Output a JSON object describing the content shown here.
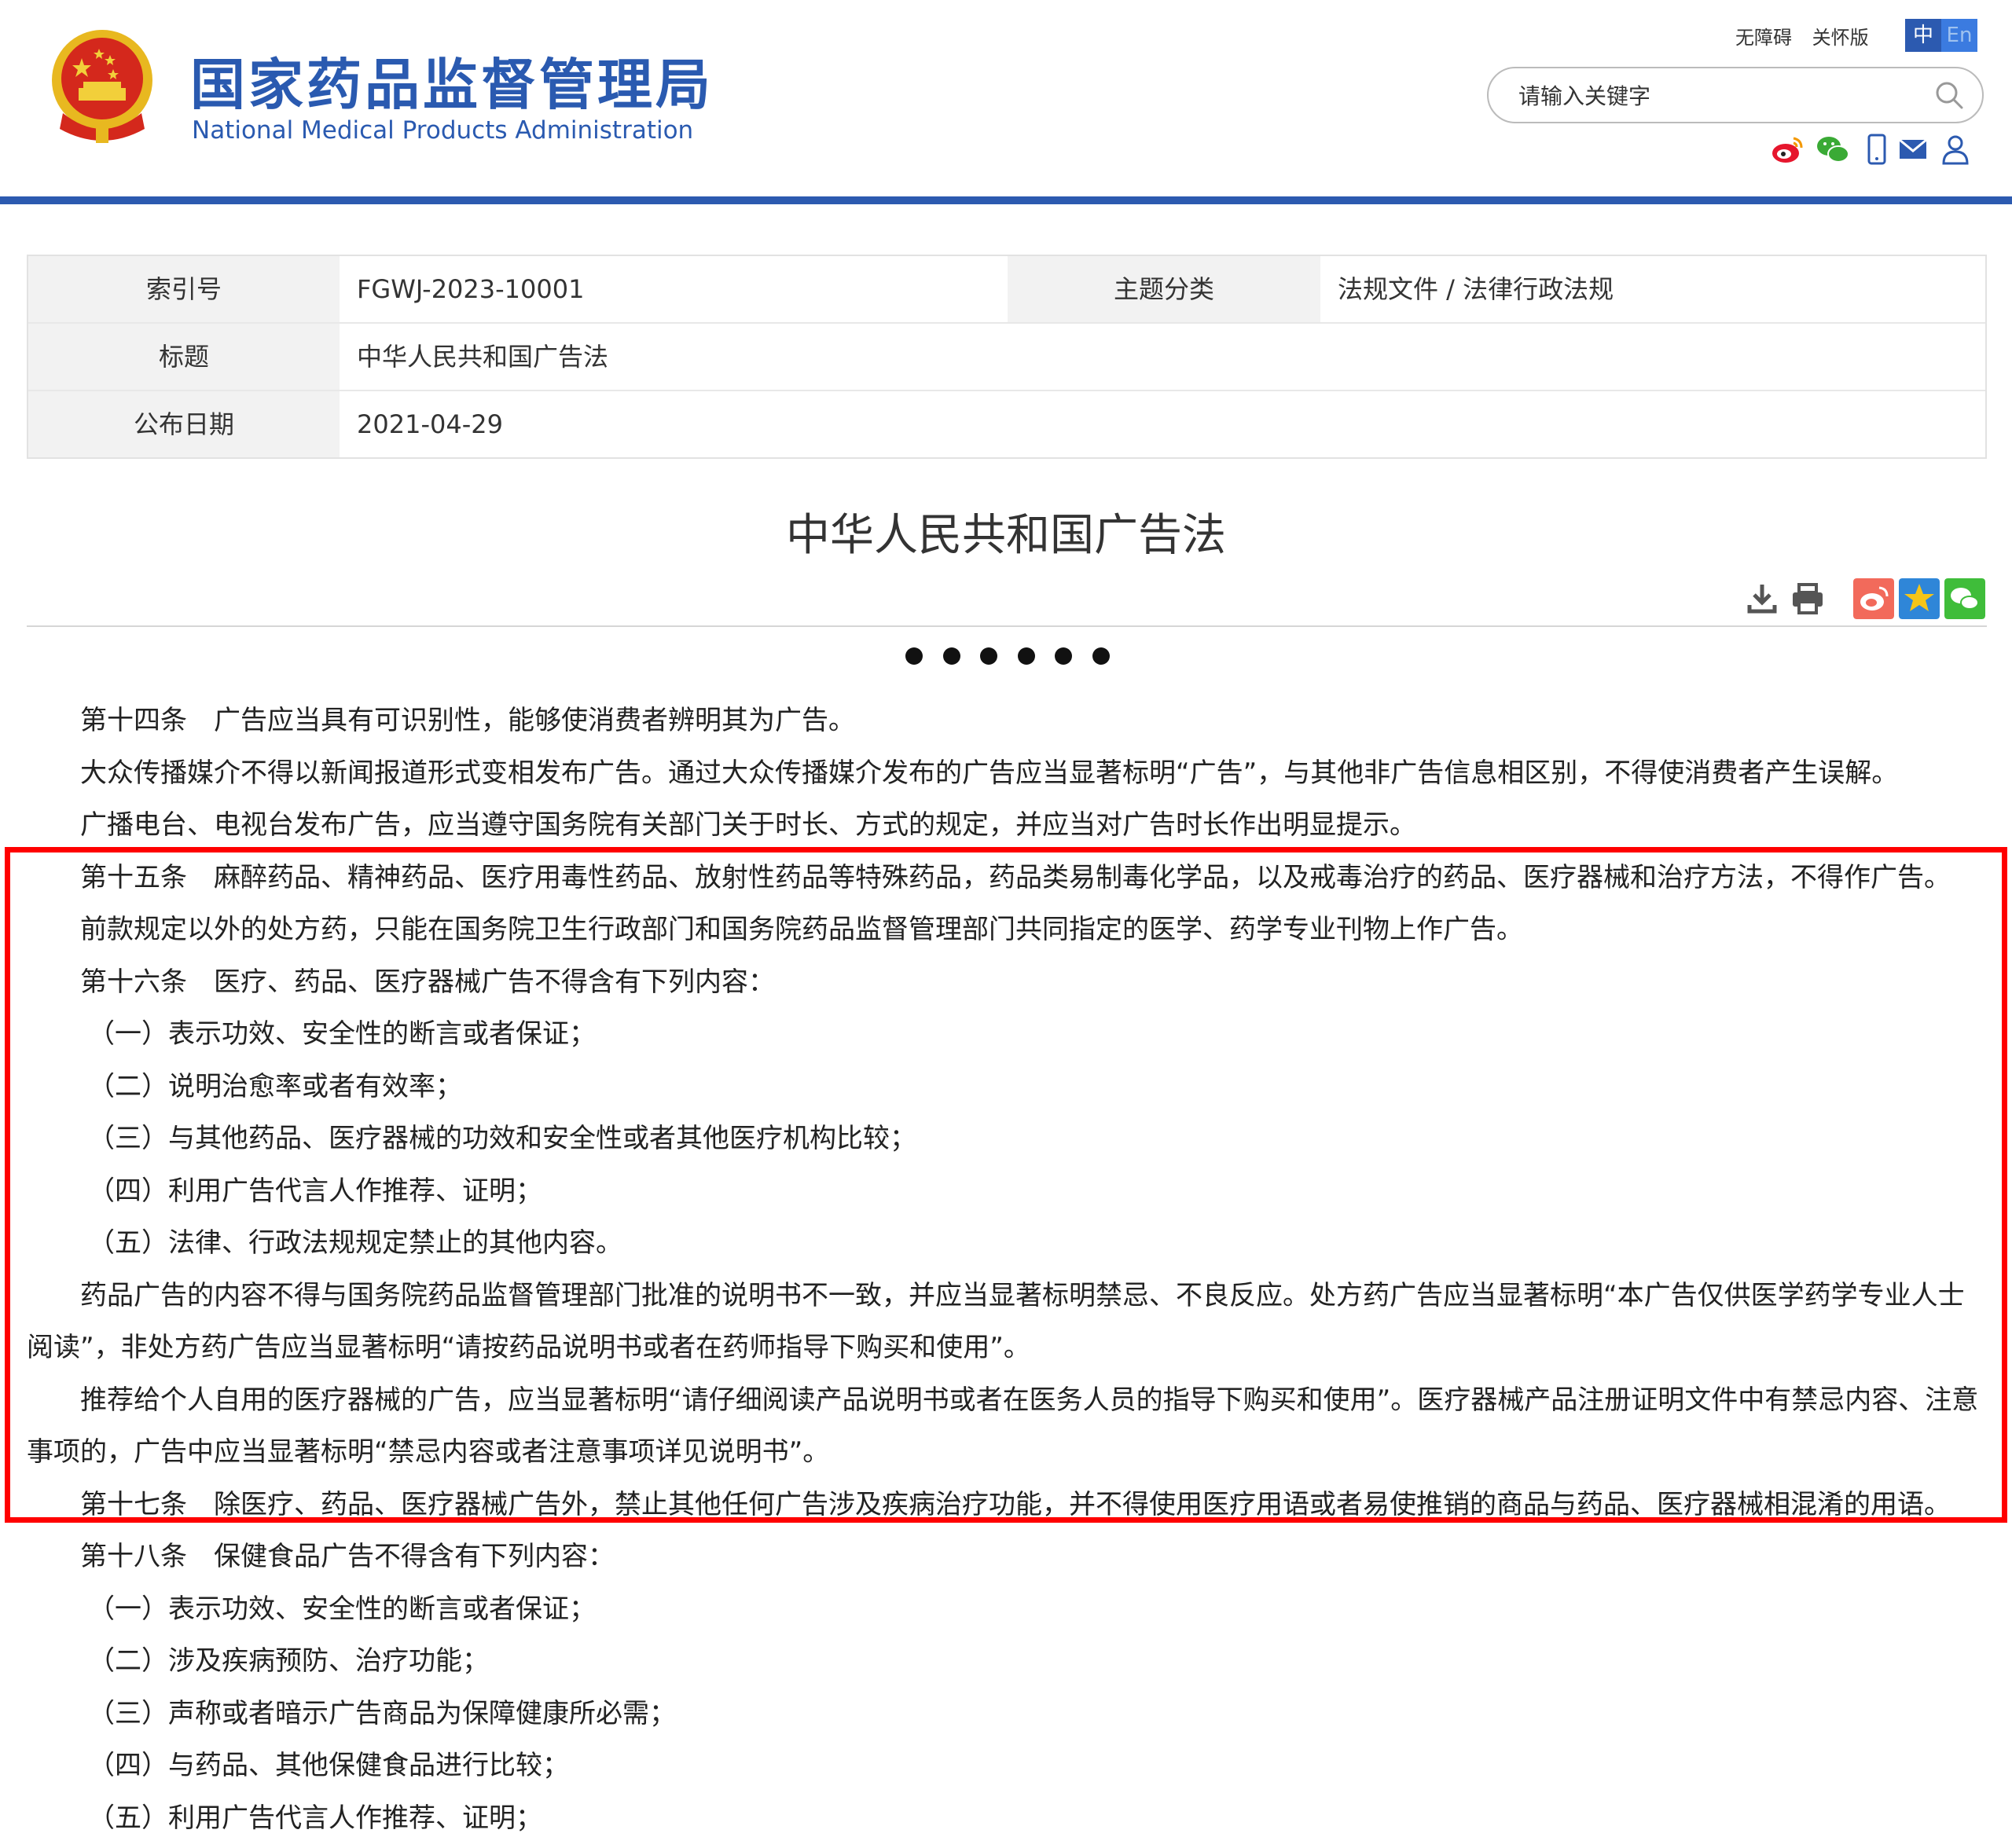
{
  "header": {
    "site_name_cn": "国家药品监督管理局",
    "site_name_en": "National Medical Products Administration",
    "top_links": [
      "无障碍",
      "关怀版"
    ],
    "lang": {
      "cn": "中",
      "en": "En"
    },
    "search": {
      "placeholder": "请输入关键字"
    },
    "social_icons": [
      "weibo-icon",
      "wechat-icon",
      "mobile-icon",
      "mail-icon",
      "user-icon"
    ],
    "brand_color": "#2c5ab0"
  },
  "meta": {
    "index_label": "索引号",
    "index_value": "FGWJ-2023-10001",
    "topic_label": "主题分类",
    "topic_value": "法规文件 / 法律行政法规",
    "title_label": "标题",
    "title_value": "中华人民共和国广告法",
    "date_label": "公布日期",
    "date_value": "2021-04-29"
  },
  "article": {
    "title": "中华人民共和国广告法",
    "tools": [
      "download-icon",
      "print-icon",
      "share-weibo-icon",
      "share-favorite-icon",
      "share-wechat-icon"
    ],
    "paragraphs": [
      "第十四条　广告应当具有可识别性，能够使消费者辨明其为广告。",
      "大众传播媒介不得以新闻报道形式变相发布广告。通过大众传播媒介发布的广告应当显著标明“广告”，与其他非广告信息相区别，不得使消费者产生误解。",
      "广播电台、电视台发布广告，应当遵守国务院有关部门关于时长、方式的规定，并应当对广告时长作出明显提示。",
      "第十五条　麻醉药品、精神药品、医疗用毒性药品、放射性药品等特殊药品，药品类易制毒化学品，以及戒毒治疗的药品、医疗器械和治疗方法，不得作广告。",
      "前款规定以外的处方药，只能在国务院卫生行政部门和国务院药品监督管理部门共同指定的医学、药学专业刊物上作广告。",
      "第十六条　医疗、药品、医疗器械广告不得含有下列内容：",
      "（一）表示功效、安全性的断言或者保证；",
      "（二）说明治愈率或者有效率；",
      "（三）与其他药品、医疗器械的功效和安全性或者其他医疗机构比较；",
      "（四）利用广告代言人作推荐、证明；",
      "（五）法律、行政法规规定禁止的其他内容。",
      "药品广告的内容不得与国务院药品监督管理部门批准的说明书不一致，并应当显著标明禁忌、不良反应。处方药广告应当显著标明“本广告仅供医学药学专业人士阅读”，非处方药广告应当显著标明“请按药品说明书或者在药师指导下购买和使用”。",
      "推荐给个人自用的医疗器械的广告，应当显著标明“请仔细阅读产品说明书或者在医务人员的指导下购买和使用”。医疗器械产品注册证明文件中有禁忌内容、注意事项的，广告中应当显著标明“禁忌内容或者注意事项详见说明书”。",
      "第十七条　除医疗、药品、医疗器械广告外，禁止其他任何广告涉及疾病治疗功能，并不得使用医疗用语或者易使推销的商品与药品、医疗器械相混淆的用语。",
      "第十八条　保健食品广告不得含有下列内容：",
      "（一）表示功效、安全性的断言或者保证；",
      "（二）涉及疾病预防、治疗功能；",
      "（三）声称或者暗示广告商品为保障健康所必需；",
      "（四）与药品、其他保健食品进行比较；",
      "（五）利用广告代言人作推荐、证明；"
    ]
  },
  "annotation": {
    "highlight_color": "#ff0000"
  }
}
